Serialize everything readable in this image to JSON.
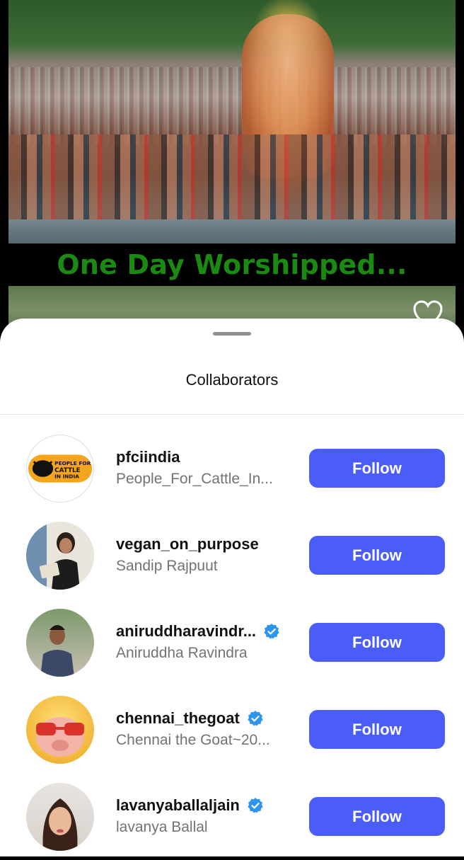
{
  "post": {
    "caption": "One Day Worshipped..."
  },
  "sheet": {
    "title": "Collaborators",
    "follow_label": "Follow",
    "accent": "#4a5df9",
    "collaborators": [
      {
        "username": "pfciindia",
        "fullname": "People_For_Cattle_In...",
        "verified": false,
        "avatar_text": "PEOPLE FOR CATTLE IN INDIA"
      },
      {
        "username": "vegan_on_purpose",
        "fullname": "Sandip Rajpuut",
        "verified": false
      },
      {
        "username": "aniruddharavindr...",
        "fullname": "Aniruddha Ravindra",
        "verified": true
      },
      {
        "username": "chennai_thegoat",
        "fullname": "Chennai the Goat~20...",
        "verified": true
      },
      {
        "username": "lavanyaballaljain",
        "fullname": "lavanya Ballal",
        "verified": true
      }
    ]
  }
}
